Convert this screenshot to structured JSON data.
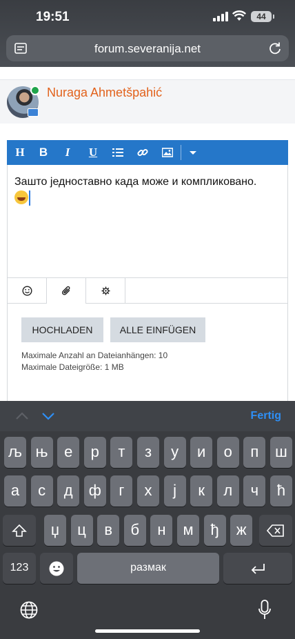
{
  "status_bar": {
    "time": "19:51",
    "battery": "44"
  },
  "browser": {
    "url": "forum.severanija.net"
  },
  "post": {
    "username": "Nuraga Ahmetšpahić",
    "text": "Зашто једноставно када може и компликовано."
  },
  "editor_toolbar": {
    "heading": "H",
    "bold": "B",
    "italic": "I",
    "underline": "U"
  },
  "attachments": {
    "upload_label": "HOCHLADEN",
    "insert_all_label": "ALLE EINFÜGEN",
    "max_files": "Maximale Anzahl an Dateianhängen: 10",
    "max_size": "Maximale Dateigröße: 1 MB"
  },
  "keyboard": {
    "done_label": "Fertig",
    "row1": [
      "љ",
      "њ",
      "е",
      "р",
      "т",
      "з",
      "у",
      "и",
      "о",
      "п",
      "ш"
    ],
    "row2": [
      "а",
      "с",
      "д",
      "ф",
      "г",
      "х",
      "ј",
      "к",
      "л",
      "ч",
      "ћ"
    ],
    "row3": [
      "џ",
      "ц",
      "в",
      "б",
      "н",
      "м",
      "ђ",
      "ж"
    ],
    "numbers_label": "123",
    "space_label": "размак"
  }
}
